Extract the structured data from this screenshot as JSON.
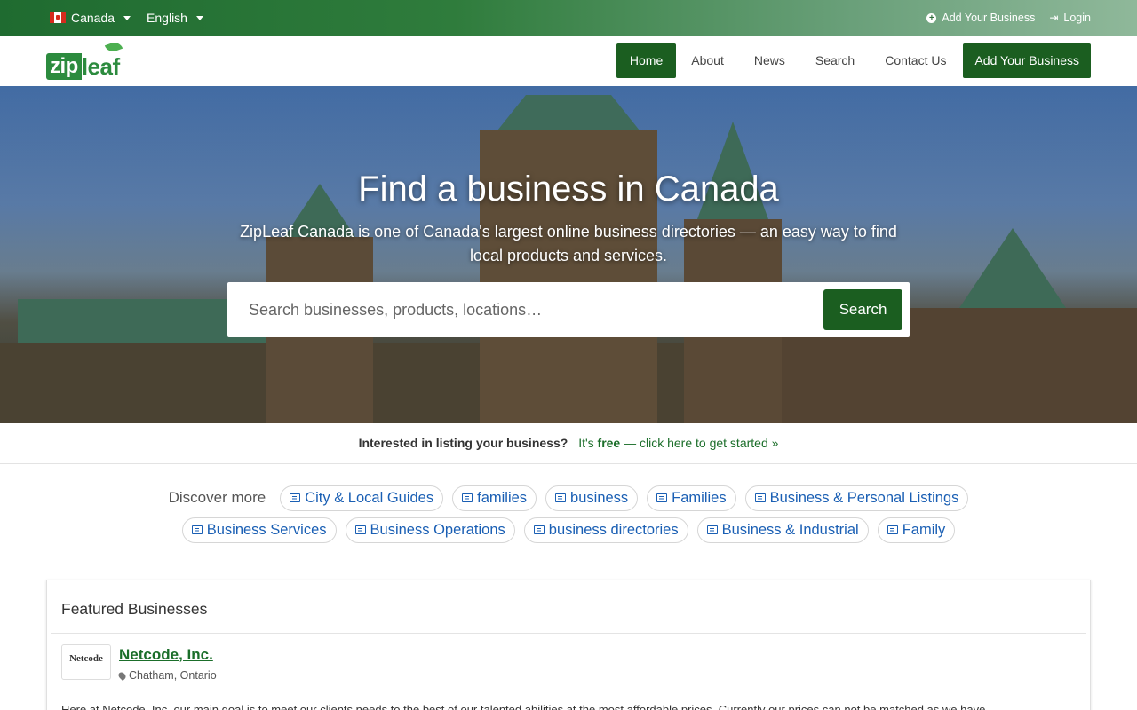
{
  "topbar": {
    "country": "Canada",
    "language": "English",
    "add_business": "Add Your Business",
    "login": "Login"
  },
  "nav": {
    "logo_zip": "zip",
    "logo_leaf": "leaf",
    "items": [
      {
        "label": "Home",
        "active": true
      },
      {
        "label": "About"
      },
      {
        "label": "News"
      },
      {
        "label": "Search"
      },
      {
        "label": "Contact Us"
      }
    ],
    "cta": "Add Your Business"
  },
  "hero": {
    "title": "Find a business in Canada",
    "subtitle": "ZipLeaf Canada is one of Canada's largest online business directories — an easy way to find local products and services.",
    "search_placeholder": "Search businesses, products, locations…",
    "search_button": "Search"
  },
  "banner": {
    "question": "Interested in listing your business?",
    "prefix": "It's",
    "free": "free",
    "link_text": "— click here to get started »"
  },
  "discover": {
    "label": "Discover more",
    "row1": [
      "City & Local Guides",
      "families",
      "business",
      "Families",
      "Business & Personal Listings"
    ],
    "row2": [
      "Business Services",
      "Business Operations",
      "business directories",
      "Business & Industrial",
      "Family"
    ]
  },
  "featured": {
    "title": "Featured Businesses",
    "business": {
      "logo_text": "Netcode",
      "name": "Netcode, Inc.",
      "location": "Chatham, Ontario",
      "description": "Here at Netcode, Inc. our main goal is to meet our clients needs to the best of our talented abilities at the most affordable prices. Currently our prices can not be matched as we have"
    }
  },
  "colors": {
    "brand_green": "#1b5e20",
    "link_blue": "#1a5fb4"
  }
}
